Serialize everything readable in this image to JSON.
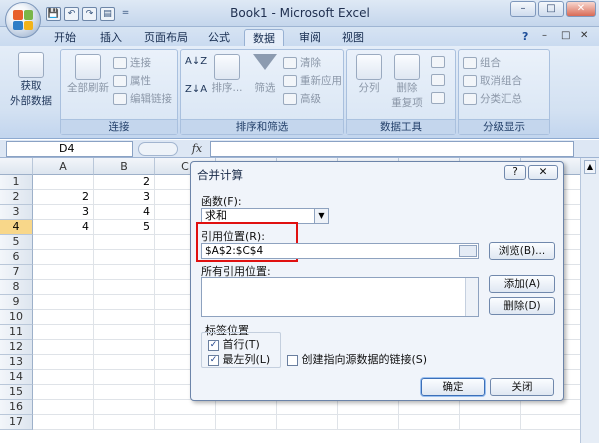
{
  "window": {
    "title": "Book1 - Microsoft Excel",
    "minimize": "–",
    "restore": "□",
    "close": "✕"
  },
  "quick_access": {
    "save": "💾",
    "undo": "↶",
    "redo": "↷",
    "print_preview": "▤",
    "customize": "="
  },
  "tabs": [
    "开始",
    "插入",
    "页面布局",
    "公式",
    "数据",
    "审阅",
    "视图"
  ],
  "active_tab": "数据",
  "ribbon_right": {
    "help": "?",
    "min": "–",
    "restore": "□",
    "close": "✕"
  },
  "ribbon": {
    "get_external": {
      "label1": "获取",
      "label2": "外部数据"
    },
    "connections": {
      "group": "连接",
      "refresh_all": "全部刷新",
      "items": [
        "连接",
        "属性",
        "编辑链接"
      ]
    },
    "sort_filter": {
      "group": "排序和筛选",
      "sort": "排序...",
      "filter": "筛选",
      "items": [
        "清除",
        "重新应用",
        "高级"
      ]
    },
    "data_tools": {
      "group": "数据工具",
      "text_to_columns": "分列",
      "remove_dup1": "删除",
      "remove_dup2": "重复项"
    },
    "outline": {
      "group": "分级显示",
      "items": [
        "组合",
        "取消组合",
        "分类汇总"
      ]
    }
  },
  "formula_bar": {
    "name_box": "D4",
    "fx": "fx",
    "value": ""
  },
  "sheet": {
    "columns": [
      "A",
      "B",
      "C",
      "D",
      "E",
      "F",
      "G",
      "H",
      "I"
    ],
    "rows": [
      "1",
      "2",
      "3",
      "4",
      "5",
      "6",
      "7",
      "8",
      "9",
      "10",
      "11",
      "12",
      "13",
      "14",
      "15",
      "16",
      "17"
    ],
    "selected_row": "4",
    "cells": {
      "B1": "2",
      "A2": "2",
      "B2": "3",
      "A3": "3",
      "B3": "4",
      "A4": "4",
      "B4": "5"
    }
  },
  "dialog": {
    "title": "合并计算",
    "help": "?",
    "close": "✕",
    "function_label": "函数(F):",
    "function_value": "求和",
    "reference_label": "引用位置(R):",
    "reference_value": "$A$2:$C$4",
    "browse": "浏览(B)...",
    "all_refs_label": "所有引用位置:",
    "add": "添加(A)",
    "delete": "删除(D)",
    "labels_group": "标签位置",
    "top_row": "首行(T)",
    "top_row_checked": true,
    "left_column": "最左列(L)",
    "left_column_checked": true,
    "create_links": "创建指向源数据的链接(S)",
    "create_links_checked": false,
    "ok": "确定",
    "close_btn": "关闭"
  },
  "colors": {
    "highlight": "#e01010",
    "selected_row": "#f8d78a"
  }
}
